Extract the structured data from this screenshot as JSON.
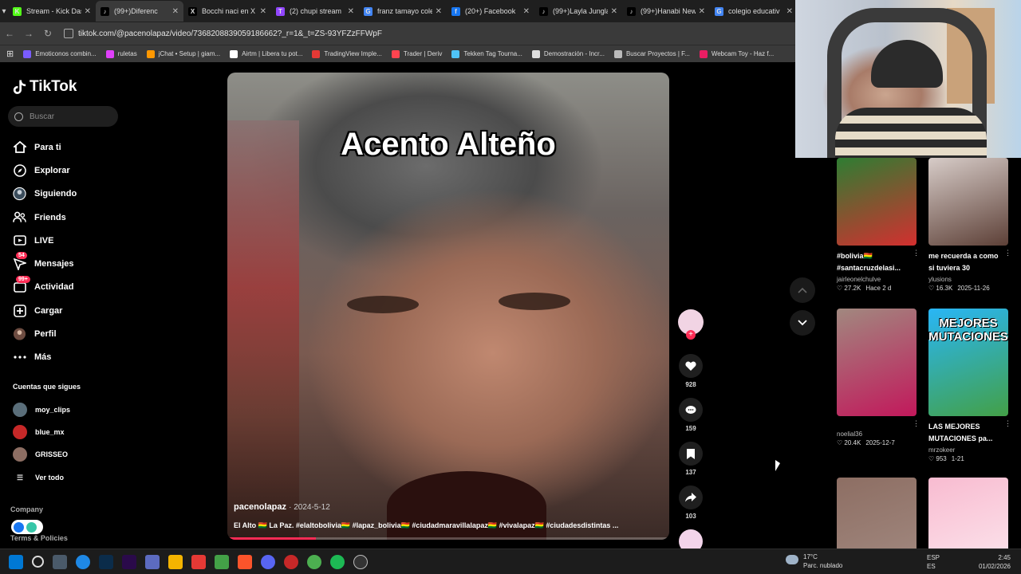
{
  "browser": {
    "tabs": [
      {
        "label": "Stream - Kick Das",
        "color": "#53fc18",
        "glyph": "K"
      },
      {
        "label": "(99+)Diferenc",
        "color": "#000000",
        "glyph": "♪",
        "active": true
      },
      {
        "label": "Bocchi naci en X",
        "color": "#000000",
        "glyph": "X"
      },
      {
        "label": "(2) chupi stream",
        "color": "#9146ff",
        "glyph": "T"
      },
      {
        "label": "franz tamayo cole",
        "color": "#4285f4",
        "glyph": "G"
      },
      {
        "label": "(20+) Facebook",
        "color": "#1877f2",
        "glyph": "f"
      },
      {
        "label": "(99+)Layla Jungla",
        "color": "#000000",
        "glyph": "♪"
      },
      {
        "label": "(99+)Hanabi New",
        "color": "#000000",
        "glyph": "♪"
      },
      {
        "label": "colegio educativ",
        "color": "#4285f4",
        "glyph": "G"
      }
    ],
    "url": "tiktok.com/@pacenolapaz/video/7368208839059186662?_r=1&_t=ZS-93YFZzFFWpF",
    "bookmarks": [
      {
        "label": "Emoticonos combin...",
        "color": "#7a5cff"
      },
      {
        "label": "ruletas",
        "color": "#e040fb"
      },
      {
        "label": "jChat • Setup | giam...",
        "color": "#ff9800"
      },
      {
        "label": "Airtm | Libera tu pot...",
        "color": "#ffffff"
      },
      {
        "label": "TradingView Imple...",
        "color": "#e53935"
      },
      {
        "label": "Trader | Deriv",
        "color": "#ff444f"
      },
      {
        "label": "Tekken Tag Tourna...",
        "color": "#4fc3f7"
      },
      {
        "label": "Demostración - Incr...",
        "color": "#dddddd"
      },
      {
        "label": "Buscar Proyectos | F...",
        "color": "#bbbbbb"
      },
      {
        "label": "Webcam Toy - Haz f...",
        "color": "#e91e63"
      }
    ]
  },
  "tiktok": {
    "brand": "TikTok",
    "search_placeholder": "Buscar",
    "nav": [
      {
        "label": "Para ti",
        "icon": "home-icon"
      },
      {
        "label": "Explorar",
        "icon": "compass-icon"
      },
      {
        "label": "Siguiendo",
        "icon": "following-avatar-icon"
      },
      {
        "label": "Friends",
        "icon": "friends-icon"
      },
      {
        "label": "LIVE",
        "icon": "live-icon"
      },
      {
        "label": "Mensajes",
        "icon": "messages-icon",
        "badge": "54"
      },
      {
        "label": "Actividad",
        "icon": "activity-icon",
        "badge": "99+"
      },
      {
        "label": "Cargar",
        "icon": "upload-icon"
      },
      {
        "label": "Perfil",
        "icon": "profile-avatar-icon"
      },
      {
        "label": "Más",
        "icon": "more-icon"
      }
    ],
    "follows_title": "Cuentas que sigues",
    "follows": [
      {
        "name": "moy_clips",
        "color": "#5a6e7a"
      },
      {
        "name": "blue_mx",
        "color": "#c62828"
      },
      {
        "name": "GRISSEO",
        "color": "#8d6e63"
      }
    ],
    "see_all": "Ver todo",
    "company": "Company",
    "terms": "Terms & Policies"
  },
  "video": {
    "overlay_title": "Acento Alteño",
    "author": "pacenolapaz",
    "date": "2024-5-12",
    "caption": "El Alto 🇧🇴 La Paz. #elaltobolivia🇧🇴 #lapaz_bolivia🇧🇴 #ciudadmaravillalapaz🇧🇴 #vivalapaz🇧🇴 #ciudadesdistintas ...",
    "progress": 0.2,
    "likes": "928",
    "comments": "159",
    "saves": "137",
    "shares": "103"
  },
  "related": [
    {
      "title": "#bolivia🇧🇴 #santacruzdelasi...",
      "author": "jairleonelchulve",
      "likes": "27.2K",
      "date": "Hace 2 d",
      "colors": [
        "#2e7d32",
        "#d32f2f"
      ]
    },
    {
      "title": "me recuerda a como si tuviera 30",
      "author": "ylusions",
      "likes": "16.3K",
      "date": "2025-11-26",
      "colors": [
        "#d7ccc8",
        "#5d4037"
      ]
    },
    {
      "title": "",
      "author": "noelial36",
      "likes": "20.4K",
      "date": "2025-12-7",
      "colors": [
        "#a1887f",
        "#c2185b"
      ]
    },
    {
      "title": "LAS MEJORES MUTACIONES pa...",
      "author": "mrzokeer",
      "likes": "953",
      "date": "1-21",
      "colors": [
        "#29b6f6",
        "#43a047"
      ],
      "thumb_text": "MEJORES MUTACIONES"
    },
    {
      "title": "",
      "author": "",
      "likes": "",
      "date": "",
      "colors": [
        "#8d6e63",
        "#a1887f"
      ]
    },
    {
      "title": "",
      "author": "",
      "likes": "",
      "date": "",
      "colors": [
        "#f8bbd0",
        "#fce4ec"
      ]
    }
  ],
  "taskbar": {
    "weather_temp": "17°C",
    "weather_desc": "Parc. nublado",
    "lang": "ESP",
    "lang2": "ES",
    "time": "2:45",
    "date": "01/02/2026"
  }
}
